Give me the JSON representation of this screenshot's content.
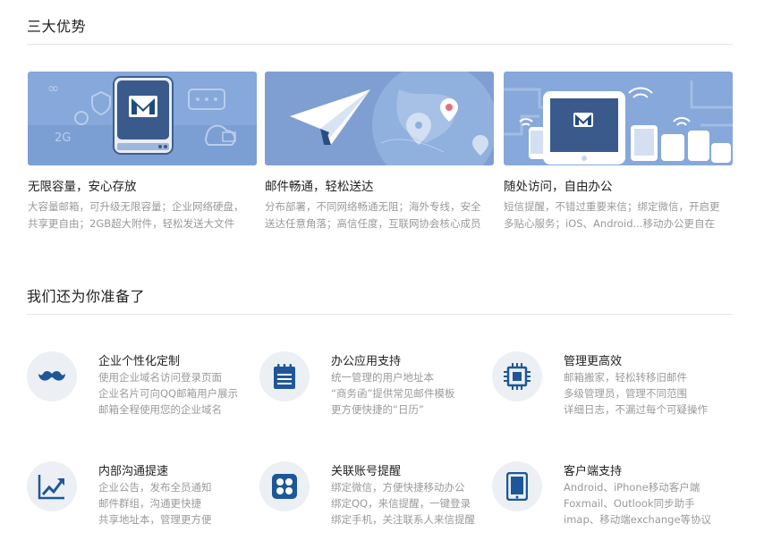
{
  "advantages_section": {
    "title": "三大优势"
  },
  "advantages": [
    {
      "title": "无限容量，安心存放",
      "desc": [
        "大容量邮箱，可升级无限容量；企业网络硬盘，",
        "共享更自由；2GB超大附件，轻松发送大文件"
      ]
    },
    {
      "title": "邮件畅通，轻松送达",
      "desc": [
        "分布部署，不同网络畅通无阻；海外专线，安全",
        "送达任意角落；高信任度，互联网协会核心成员"
      ]
    },
    {
      "title": "随处访问，自由办公",
      "desc": [
        "短信提醒，不错过重要来信；绑定微信，开启更",
        "多贴心服务；iOS、Android...移动办公更自在"
      ]
    }
  ],
  "features_section": {
    "title": "我们还为你准备了"
  },
  "features": [
    {
      "icon": "mustache-icon",
      "title": "企业个性化定制",
      "lines": [
        "使用企业域名访问登录页面",
        "企业名片可向QQ邮箱用户展示",
        "邮箱全程使用您的企业域名"
      ]
    },
    {
      "icon": "notepad-icon",
      "title": "办公应用支持",
      "lines": [
        "统一管理的用户地址本",
        "“商务函”提供常见邮件模板",
        "更方便快捷的“日历”"
      ]
    },
    {
      "icon": "chip-icon",
      "title": "管理更高效",
      "lines": [
        "邮箱搬家，轻松转移旧邮件",
        "多级管理员，管理不同范围",
        "详细日志，不漏过每个可疑操作"
      ]
    },
    {
      "icon": "trend-chart-icon",
      "title": "内部沟通提速",
      "lines": [
        "企业公告，发布全员通知",
        "邮件群组，沟通更快捷",
        "共享地址本，管理更方便"
      ]
    },
    {
      "icon": "linked-accounts-icon",
      "title": "关联账号提醒",
      "lines": [
        "绑定微信，方便快捷移动办公",
        "绑定QQ，来信提醒，一键登录",
        "绑定手机，关注联系人来信提醒"
      ]
    },
    {
      "icon": "tablet-icon",
      "title": "客户端支持",
      "lines": [
        "Android、iPhone移动客户端",
        "Foxmail、Outlook同步助手",
        "imap、移动端exchange等协议"
      ]
    }
  ],
  "colors": {
    "accent": "#1e5799",
    "banner_bg": "#7fa3d6",
    "icon_circle": "#ecf0f4"
  }
}
